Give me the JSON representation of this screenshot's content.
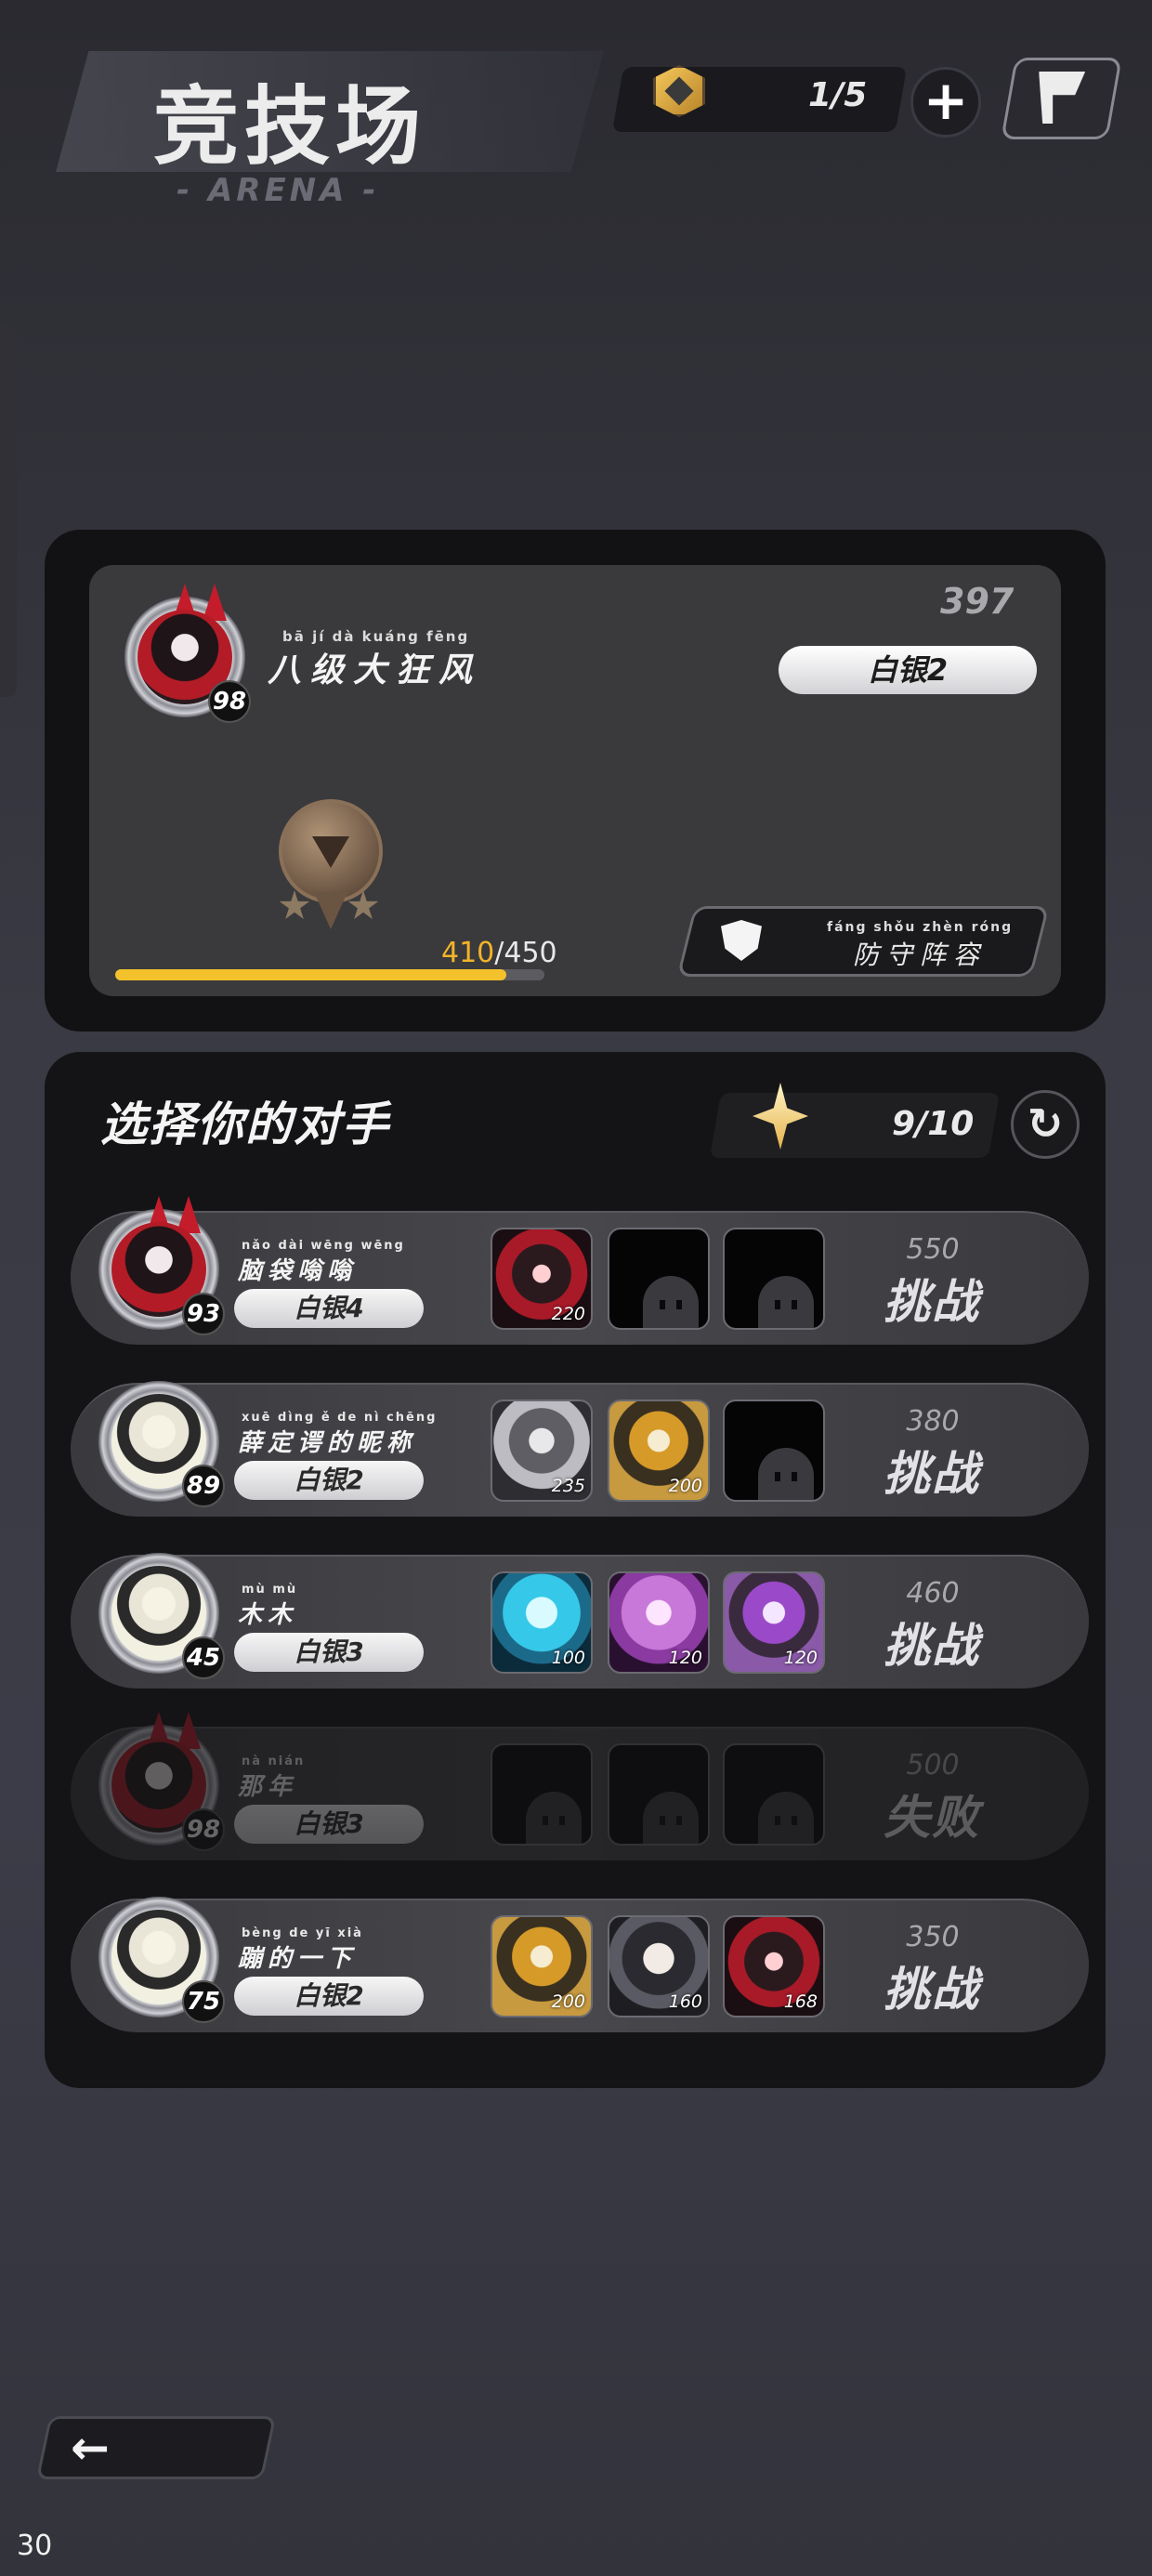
{
  "header": {
    "title": "竞技场",
    "subtitle": "- ARENA -",
    "currency": "1/5",
    "plus_label": "+"
  },
  "player": {
    "name_pinyin": "bā  jí  dà  kuáng fēng",
    "name": "八级大狂风",
    "level": "98",
    "score": "397",
    "rank": "白银2",
    "xp_current": "410",
    "xp_total": "/450",
    "xp_progress": 0.911,
    "defense_pinyin": "fáng shǒu zhèn róng",
    "defense_label": "防守阵容"
  },
  "opponents_section": {
    "title": "选择你的对手",
    "tickets": "9/10",
    "refresh_icon": "refresh-icon"
  },
  "opponents": [
    {
      "pinyin": "nǎo dài wēng wēng",
      "name": "脑袋嗡嗡",
      "level": "93",
      "rank": "白银4",
      "score": "550",
      "action": "挑战",
      "team": [
        {
          "power": "220",
          "style": "red"
        },
        {
          "power": "",
          "style": "empty"
        },
        {
          "power": "",
          "style": "empty"
        }
      ]
    },
    {
      "pinyin": "xuē dìng  ě   de  nì chēng",
      "name": "薛定谔的昵称",
      "level": "89",
      "rank": "白银2",
      "score": "380",
      "action": "挑战",
      "team": [
        {
          "power": "235",
          "style": "gray"
        },
        {
          "power": "200",
          "style": "gold"
        },
        {
          "power": "",
          "style": "empty"
        }
      ]
    },
    {
      "pinyin": "mù mù",
      "name": "木木",
      "level": "45",
      "rank": "白银3",
      "score": "460",
      "action": "挑战",
      "team": [
        {
          "power": "100",
          "style": "cyan"
        },
        {
          "power": "120",
          "style": "pink"
        },
        {
          "power": "120",
          "style": "violet"
        }
      ]
    },
    {
      "pinyin": "nà nián",
      "name": "那年",
      "level": "98",
      "rank": "白银3",
      "score": "500",
      "action": "失败",
      "team": [
        {
          "power": "",
          "style": "empty"
        },
        {
          "power": "",
          "style": "empty"
        },
        {
          "power": "",
          "style": "empty"
        }
      ]
    },
    {
      "pinyin": "bèng de  yī  xià",
      "name": "蹦的一下",
      "level": "75",
      "rank": "白银2",
      "score": "350",
      "action": "挑战",
      "team": [
        {
          "power": "200",
          "style": "gold"
        },
        {
          "power": "160",
          "style": "dark"
        },
        {
          "power": "168",
          "style": "red"
        }
      ]
    }
  ],
  "footer": {
    "fps": "30"
  }
}
